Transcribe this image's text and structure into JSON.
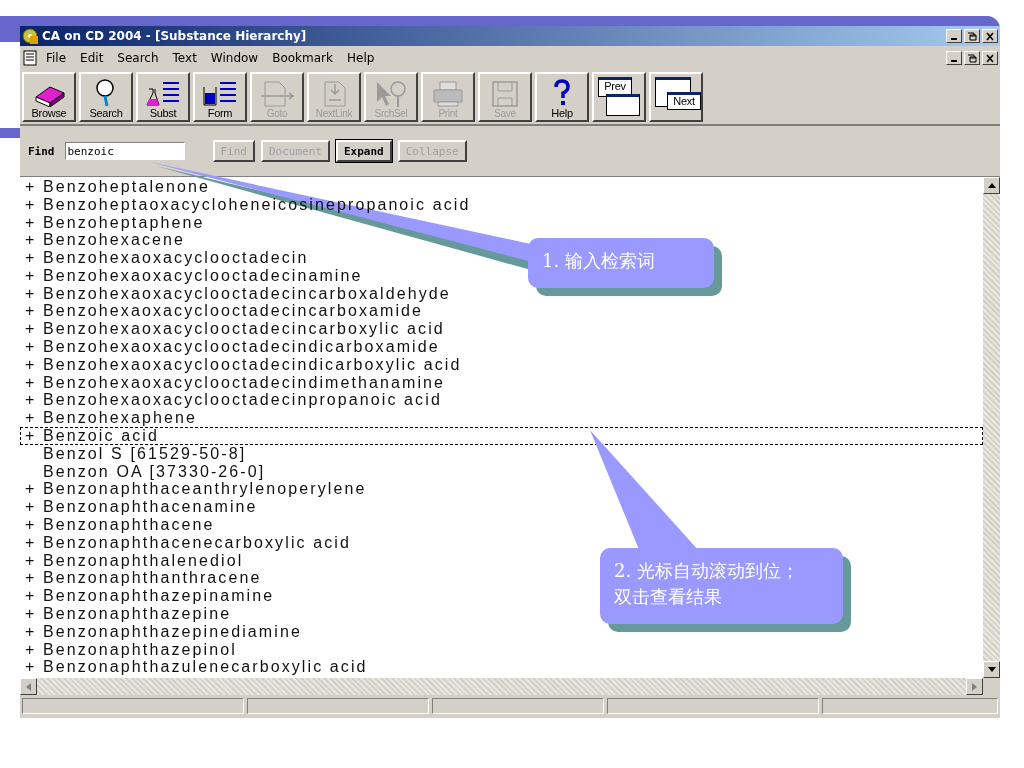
{
  "window": {
    "title": "CA on CD 2004 - [Substance Hierarchy]"
  },
  "menu": [
    {
      "label": "File"
    },
    {
      "label": "Edit"
    },
    {
      "label": "Search"
    },
    {
      "label": "Text"
    },
    {
      "label": "Window"
    },
    {
      "label": "Bookmark"
    },
    {
      "label": "Help"
    }
  ],
  "toolbar": [
    {
      "label": "Browse",
      "kind": "books",
      "disabled": false
    },
    {
      "label": "Search",
      "kind": "magnifier",
      "disabled": false
    },
    {
      "label": "Subst",
      "kind": "flask",
      "disabled": false
    },
    {
      "label": "Form",
      "kind": "beaker",
      "disabled": false
    },
    {
      "label": "Goto",
      "kind": "doc-chain",
      "disabled": true
    },
    {
      "label": "NextLink",
      "kind": "doc-link",
      "disabled": true
    },
    {
      "label": "SrchSel",
      "kind": "pointer-magnifier",
      "disabled": true
    },
    {
      "label": "Print",
      "kind": "printer",
      "disabled": true
    },
    {
      "label": "Save",
      "kind": "floppy",
      "disabled": true
    },
    {
      "label": "Help",
      "kind": "question",
      "disabled": false
    },
    {
      "label": "Prev",
      "kind": "window-prev",
      "disabled": false
    },
    {
      "label": "Next",
      "kind": "window-next",
      "disabled": false
    }
  ],
  "find_bar": {
    "label": "Find",
    "value": "benzoic",
    "buttons": [
      {
        "label": "Find",
        "disabled": true
      },
      {
        "label": "Document",
        "disabled": true
      },
      {
        "label": "Expand",
        "disabled": false
      },
      {
        "label": "Collapse",
        "disabled": true
      }
    ]
  },
  "tree": [
    {
      "expander": "+",
      "label": "Benzoheptalenone",
      "focused": false
    },
    {
      "expander": "+",
      "label": "Benzoheptaoxacycloheneicosinepropanoic acid",
      "focused": false
    },
    {
      "expander": "+",
      "label": "Benzoheptaphene",
      "focused": false
    },
    {
      "expander": "+",
      "label": "Benzohexacene",
      "focused": false
    },
    {
      "expander": "+",
      "label": "Benzohexaoxacyclooctadecin",
      "focused": false
    },
    {
      "expander": "+",
      "label": "Benzohexaoxacyclooctadecinamine",
      "focused": false
    },
    {
      "expander": "+",
      "label": "Benzohexaoxacyclooctadecincarboxaldehyde",
      "focused": false
    },
    {
      "expander": "+",
      "label": "Benzohexaoxacyclooctadecincarboxamide",
      "focused": false
    },
    {
      "expander": "+",
      "label": "Benzohexaoxacyclooctadecincarboxylic acid",
      "focused": false
    },
    {
      "expander": "+",
      "label": "Benzohexaoxacyclooctadecindicarboxamide",
      "focused": false
    },
    {
      "expander": "+",
      "label": "Benzohexaoxacyclooctadecindicarboxylic acid",
      "focused": false
    },
    {
      "expander": "+",
      "label": "Benzohexaoxacyclooctadecindimethanamine",
      "focused": false
    },
    {
      "expander": "+",
      "label": "Benzohexaoxacyclooctadecinpropanoic acid",
      "focused": false
    },
    {
      "expander": "+",
      "label": "Benzohexaphene",
      "focused": false
    },
    {
      "expander": "+",
      "label": "Benzoic acid",
      "focused": true
    },
    {
      "label": "Benzol S [61529-50-8]",
      "focused": false
    },
    {
      "label": "Benzon OA [37330-26-0]",
      "focused": false
    },
    {
      "expander": "+",
      "label": "Benzonaphthaceanthrylenoperylene",
      "focused": false
    },
    {
      "expander": "+",
      "label": "Benzonaphthacenamine",
      "focused": false
    },
    {
      "expander": "+",
      "label": "Benzonaphthacene",
      "focused": false
    },
    {
      "expander": "+",
      "label": "Benzonaphthacenecarboxylic acid",
      "focused": false
    },
    {
      "expander": "+",
      "label": "Benzonaphthalenediol",
      "focused": false
    },
    {
      "expander": "+",
      "label": "Benzonaphthanthracene",
      "focused": false
    },
    {
      "expander": "+",
      "label": "Benzonaphthazepinamine",
      "focused": false
    },
    {
      "expander": "+",
      "label": "Benzonaphthazepine",
      "focused": false
    },
    {
      "expander": "+",
      "label": "Benzonaphthazepinediamine",
      "focused": false
    },
    {
      "expander": "+",
      "label": "Benzonaphthazepinol",
      "focused": false
    },
    {
      "expander": "+",
      "label": "Benzonaphthazulenecarboxylic acid",
      "focused": false
    }
  ],
  "callouts": [
    {
      "lines": [
        "1. 输入检索词"
      ]
    },
    {
      "lines": [
        "2. 光标自动滚动到位；",
        "双击查看结果"
      ]
    }
  ]
}
